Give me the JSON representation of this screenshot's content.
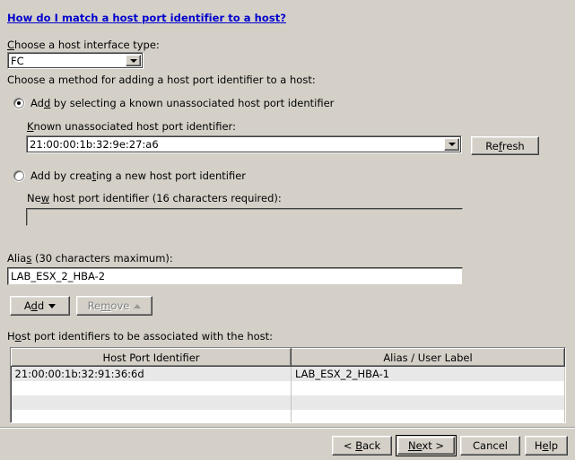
{
  "help_link": {
    "text": "How do I match a host port identifier to a host?"
  },
  "interface_type": {
    "label_pre": "C",
    "label_post": "hoose a host interface type:",
    "value": "FC",
    "dropdown_icon": "chevron-down-icon"
  },
  "method_label": "Choose a method for adding a host port identifier to a host:",
  "option_known": {
    "label_a": "Ad",
    "label_b": "d",
    "label_c": " by selecting a known unassociated host port identifier",
    "selected": true,
    "field_label_a": "K",
    "field_label_b": "nown unassociated host port identifier:",
    "value": "21:00:00:1b:32:9e:27:a6",
    "dropdown_icon": "chevron-down-icon"
  },
  "refresh_button": {
    "label_a": "Re",
    "label_b": "f",
    "label_c": "resh"
  },
  "option_new": {
    "label_a": "Add by crea",
    "label_b": "t",
    "label_c": "ing a new host port identifier",
    "selected": false,
    "field_label_a": "Ne",
    "field_label_b": "w",
    "field_label_c": " host port identifier (16 characters required):",
    "value": "",
    "disabled": true
  },
  "alias": {
    "label_a": "Alia",
    "label_b": "s",
    "label_c": " (30 characters maximum):",
    "value": "LAB_ESX_2_HBA-2"
  },
  "add_button": {
    "label_a": "A",
    "label_b": "d",
    "label_c": "d",
    "arrow": "triangle-down-icon",
    "enabled": true
  },
  "remove_button": {
    "label_a": "Re",
    "label_b": "m",
    "label_c": "ove",
    "arrow": "triangle-up-icon",
    "enabled": false
  },
  "table": {
    "caption_a": "H",
    "caption_b": "o",
    "caption_c": "st port identifiers to be associated with the host:",
    "columns": [
      "Host Port Identifier",
      "Alias / User Label"
    ],
    "rows": [
      {
        "identifier": "21:00:00:1b:32:91:36:6d",
        "alias": "LAB_ESX_2_HBA-1"
      },
      {
        "identifier": "",
        "alias": ""
      },
      {
        "identifier": "",
        "alias": ""
      },
      {
        "identifier": "",
        "alias": ""
      }
    ]
  },
  "nav": {
    "back": {
      "a": "< ",
      "b": "B",
      "c": "ack"
    },
    "next": {
      "a": "N",
      "b": "e",
      "c": "xt >"
    },
    "cancel": {
      "a": "",
      "b": "",
      "c": "Cancel"
    },
    "help": {
      "a": "H",
      "b": "e",
      "c": "lp"
    }
  },
  "colors": {
    "window_bg": "#d4d0c8",
    "link": "#0000cc",
    "field_bg": "#ffffff",
    "disabled_text": "#808080",
    "row_alt": "#e8e8e8"
  }
}
